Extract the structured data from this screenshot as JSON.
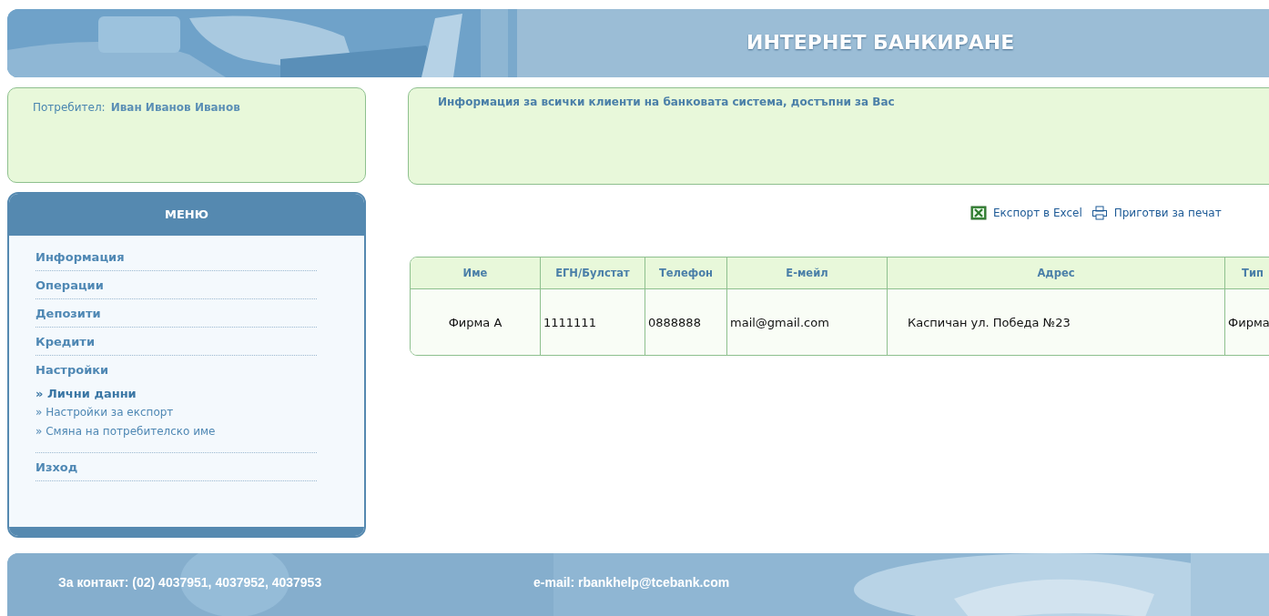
{
  "header": {
    "title": "ИНТЕРНЕТ БАНКИРАНЕ",
    "kind": "picture"
  },
  "user_panel": {
    "label": "Потребител:",
    "name": "Иван Иванов Иванов"
  },
  "info_panel": {
    "text": "Информация за всички клиенти на банковата система, достъпни за Вас"
  },
  "menu": {
    "title": "МЕНЮ",
    "items": [
      {
        "label": "Информация",
        "selected": false
      },
      {
        "label": "Операции",
        "selected": false
      },
      {
        "label": "Депозити",
        "selected": false
      },
      {
        "label": "Кредити",
        "selected": false
      },
      {
        "label": "Настройки",
        "selected": false,
        "children": [
          {
            "marker": "»",
            "label": "Лични данни",
            "selected": true
          },
          {
            "marker": "»",
            "label": "Настройки за експорт",
            "selected": false
          },
          {
            "marker": "»",
            "label": "Смяна на потребителско име",
            "selected": false
          }
        ]
      },
      {
        "label": "Изход",
        "selected": false
      }
    ]
  },
  "actions": [
    {
      "kind": "excel",
      "label": "Експорт в Excel"
    },
    {
      "kind": "print",
      "label": "Приготви за печат"
    }
  ],
  "table": {
    "columns": [
      "Име",
      "ЕГН/Булстат",
      "Телефон",
      "Е-мейл",
      "Адрес",
      "Тип"
    ],
    "rows": [
      [
        "Фирма А",
        "1111111",
        "0888888",
        "mail@gmail.com",
        "Каспичан ул. Победа №23",
        "Фирма"
      ]
    ]
  },
  "footer": {
    "contact": "За контакт: (02) 4037951, 4037952, 4037953",
    "email": "e-mail: rbankhelp@tcebank.com"
  }
}
